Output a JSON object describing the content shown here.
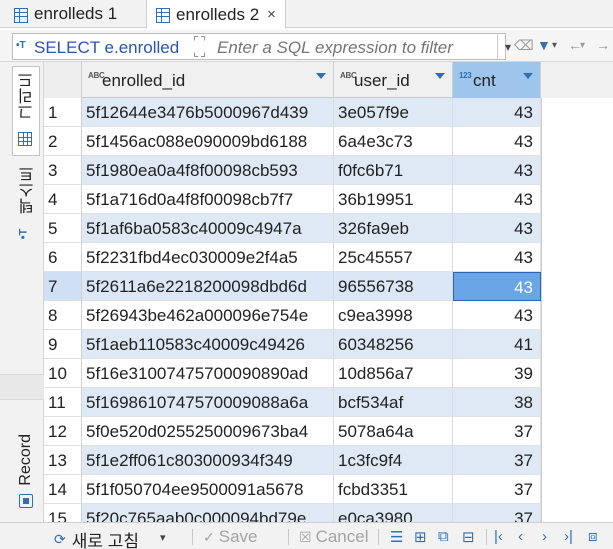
{
  "tabs": [
    {
      "label": "enrolleds 1",
      "active": false
    },
    {
      "label": "enrolleds 2",
      "active": true,
      "close": "×"
    }
  ],
  "filter": {
    "sql_prefix": "SELECT e.enrolled",
    "placeholder": "Enter a SQL expression to filter"
  },
  "sidebar": {
    "grid_label": "그리드",
    "text_label": "텍스트",
    "record_label": "Record"
  },
  "grid": {
    "columns": [
      {
        "type_icon": "ABC",
        "label": "enrolled_id"
      },
      {
        "type_icon": "ABC",
        "label": "user_id"
      },
      {
        "type_icon": "123",
        "label": "cnt"
      }
    ],
    "selected_row": 7,
    "rows": [
      {
        "num": "1",
        "enrolled_id": "5f12644e3476b5000967d439",
        "user_id": "3e057f9e",
        "cnt": "43"
      },
      {
        "num": "2",
        "enrolled_id": "5f1456ac088e090009bd6188",
        "user_id": "6a4e3c73",
        "cnt": "43"
      },
      {
        "num": "3",
        "enrolled_id": "5f1980ea0a4f8f00098cb593",
        "user_id": "f0fc6b71",
        "cnt": "43"
      },
      {
        "num": "4",
        "enrolled_id": "5f1a716d0a4f8f00098cb7f7",
        "user_id": "36b19951",
        "cnt": "43"
      },
      {
        "num": "5",
        "enrolled_id": "5f1af6ba0583c40009c4947a",
        "user_id": "326fa9eb",
        "cnt": "43"
      },
      {
        "num": "6",
        "enrolled_id": "5f2231fbd4ec030009e2f4a5",
        "user_id": "25c45557",
        "cnt": "43"
      },
      {
        "num": "7",
        "enrolled_id": "5f2611a6e2218200098dbd6d",
        "user_id": "96556738",
        "cnt": "43"
      },
      {
        "num": "8",
        "enrolled_id": "5f26943be462a000096e754e",
        "user_id": "c9ea3998",
        "cnt": "43"
      },
      {
        "num": "9",
        "enrolled_id": "5f1aeb110583c40009c49426",
        "user_id": "60348256",
        "cnt": "41"
      },
      {
        "num": "10",
        "enrolled_id": "5f16e31007475700090890ad",
        "user_id": "10d856a7",
        "cnt": "39"
      },
      {
        "num": "11",
        "enrolled_id": "5f1698610747570009088a6a",
        "user_id": "bcf534af",
        "cnt": "38"
      },
      {
        "num": "12",
        "enrolled_id": "5f0e520d0255250009673ba4",
        "user_id": "5078a64a",
        "cnt": "37"
      },
      {
        "num": "13",
        "enrolled_id": "5f1e2ff061c803000934f349",
        "user_id": "1c3fc9f4",
        "cnt": "37"
      },
      {
        "num": "14",
        "enrolled_id": "5f1f050704ee9500091a5678",
        "user_id": "fcbd3351",
        "cnt": "37"
      },
      {
        "num": "15",
        "enrolled_id": "5f20c765aab0c000094bd79e",
        "user_id": "e0ca3980",
        "cnt": "37"
      }
    ]
  },
  "bottom": {
    "refresh_label": "새로 고침",
    "save_label": "Save",
    "cancel_label": "Cancel"
  },
  "colors": {
    "accent": "#2f6fb3",
    "row_stripe": "#dfe8f5",
    "selected_cell": "#6aa5e6",
    "header_selected": "#9ec5ec"
  }
}
